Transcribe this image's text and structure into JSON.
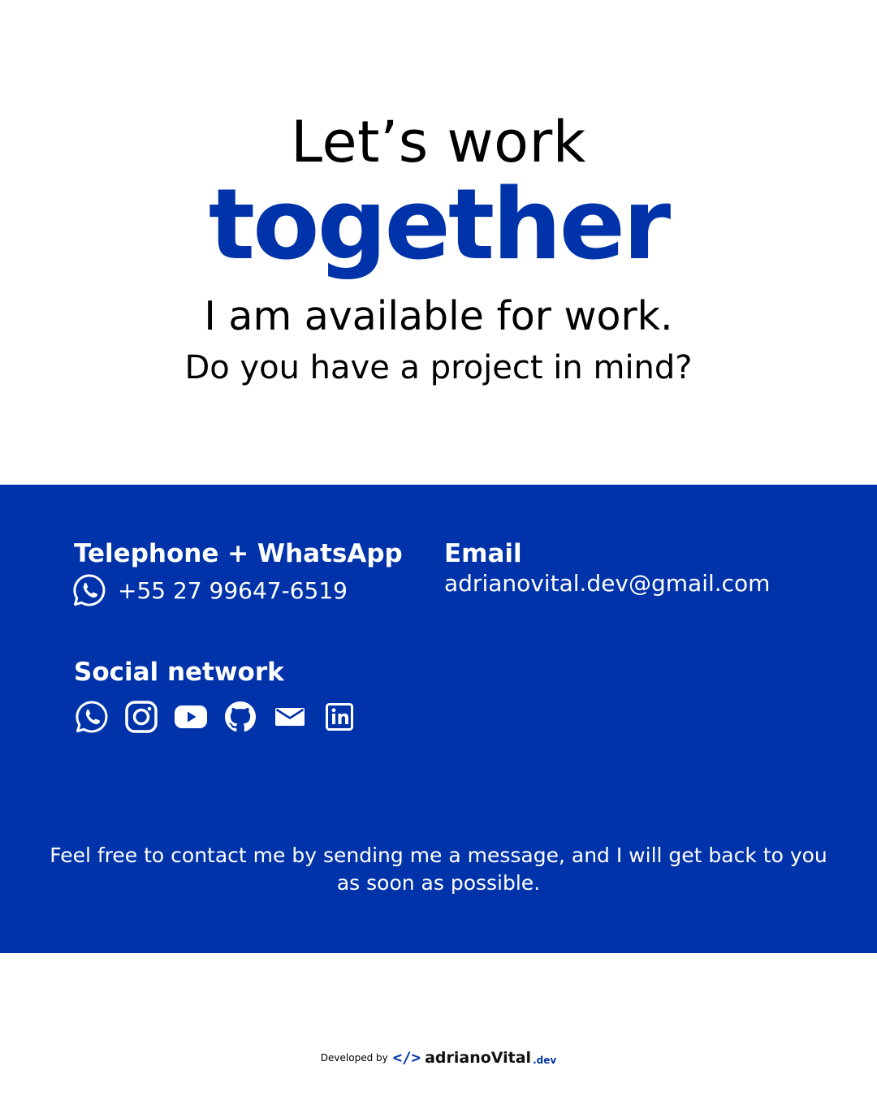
{
  "hero": {
    "line1": "Let’s work",
    "line2": "together",
    "line3": "I am available for work.",
    "line4": "Do you have a project in mind?"
  },
  "contact": {
    "phone_title": "Telephone  + WhatsApp",
    "phone_number": "+55 27 99647-6519",
    "phone_icon": "whatsapp-icon",
    "email_title": "Email",
    "email_address": "adrianovital.dev@gmail.com",
    "social_title": "Social network",
    "social_icons": [
      "whatsapp-icon",
      "instagram-icon",
      "youtube-icon",
      "github-icon",
      "mail-icon",
      "linkedin-icon"
    ],
    "message": "Feel free to contact me by sending me a message, and I will get back to you as soon as possible."
  },
  "footer": {
    "label": "Developed by",
    "logo_glyph": "</>",
    "logo_name": "adrianoVital",
    "logo_tld": ".dev"
  },
  "colors": {
    "brand_blue": "#0033aa",
    "background": "#ffffff",
    "text_on_blue": "#ffffff"
  }
}
